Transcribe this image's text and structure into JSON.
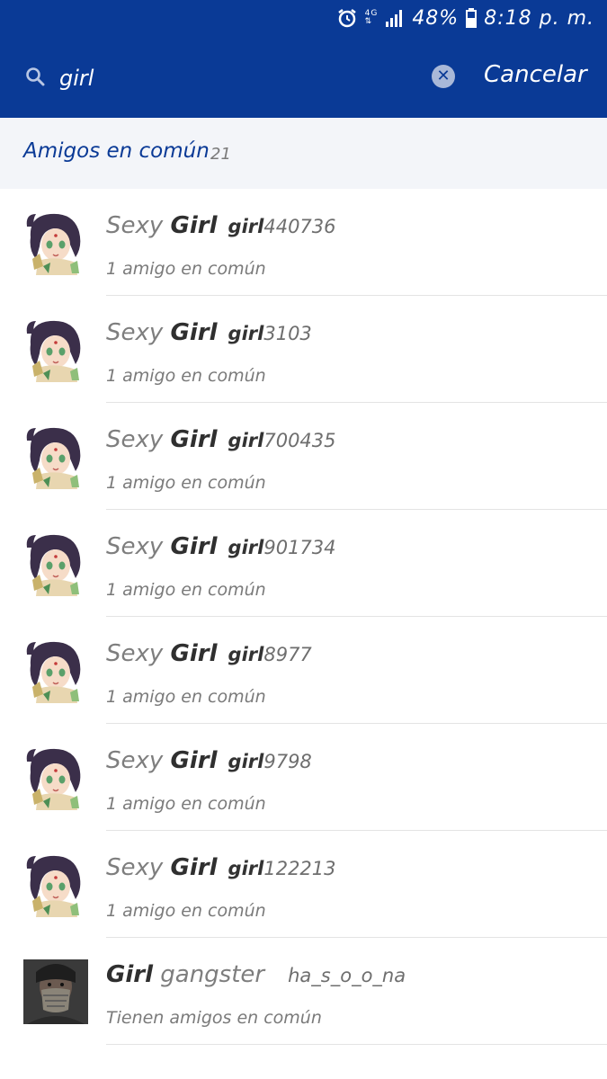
{
  "status_bar": {
    "network": "4G LTE",
    "battery": "48%",
    "time": "8:18 p. m."
  },
  "search": {
    "query": "girl",
    "cancel_label": "Cancelar"
  },
  "section": {
    "title": "Amigos en común",
    "count": "21"
  },
  "results": [
    {
      "name_pre": "Sexy ",
      "name_bold": "Girl",
      "name_post": "",
      "handle_bold": "girl",
      "handle": "440736",
      "subtitle": "1 amigo en común",
      "avatar": "anime-girl"
    },
    {
      "name_pre": "Sexy ",
      "name_bold": "Girl",
      "name_post": "",
      "handle_bold": "girl",
      "handle": "3103",
      "subtitle": "1 amigo en común",
      "avatar": "anime-girl"
    },
    {
      "name_pre": "Sexy ",
      "name_bold": "Girl",
      "name_post": "",
      "handle_bold": "girl",
      "handle": "700435",
      "subtitle": "1 amigo en común",
      "avatar": "anime-girl"
    },
    {
      "name_pre": "Sexy ",
      "name_bold": "Girl",
      "name_post": "",
      "handle_bold": "girl",
      "handle": "901734",
      "subtitle": "1 amigo en común",
      "avatar": "anime-girl"
    },
    {
      "name_pre": "Sexy ",
      "name_bold": "Girl",
      "name_post": "",
      "handle_bold": "girl",
      "handle": "8977",
      "subtitle": "1 amigo en común",
      "avatar": "anime-girl"
    },
    {
      "name_pre": "Sexy ",
      "name_bold": "Girl",
      "name_post": "",
      "handle_bold": "girl",
      "handle": "9798",
      "subtitle": "1 amigo en común",
      "avatar": "anime-girl"
    },
    {
      "name_pre": "Sexy ",
      "name_bold": "Girl",
      "name_post": "",
      "handle_bold": "girl",
      "handle": "122213",
      "subtitle": "1 amigo en común",
      "avatar": "anime-girl"
    },
    {
      "name_pre": "",
      "name_bold": "Girl",
      "name_post": " gangster",
      "handle_bold": "",
      "handle": "ha_s_o_o_na",
      "subtitle": "Tienen amigos en común",
      "avatar": "masked-person"
    }
  ],
  "colors": {
    "header_blue": "#0a3a96",
    "section_bg": "#f3f5f9"
  }
}
